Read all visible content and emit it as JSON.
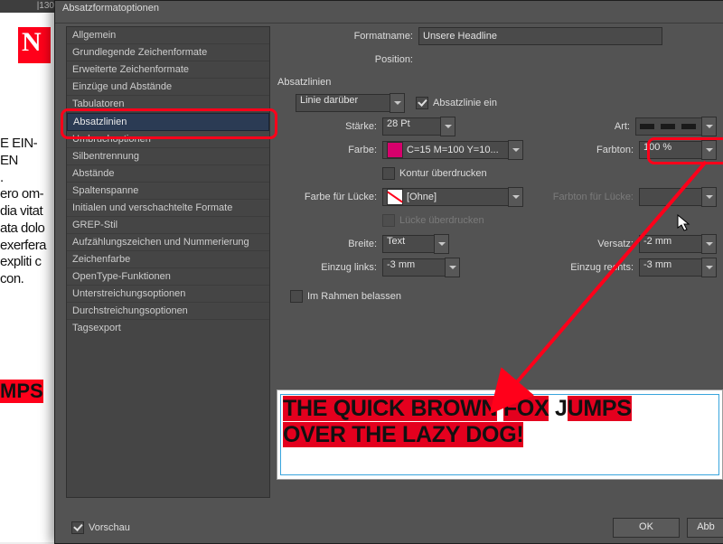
{
  "ruler": "|130",
  "doc": {
    "lines": [
      "E EIN-",
      "EN",
      ".",
      " ",
      "ero om-",
      "dia vitat",
      "ata dolo",
      "exerfera",
      " ",
      "expliti c",
      "con."
    ],
    "jumps": "MPS"
  },
  "dialog": {
    "title": "Absatzformatoptionen"
  },
  "formatname": {
    "label": "Formatname:",
    "value": "Unsere Headline"
  },
  "position_label": "Position:",
  "section": "Absatzlinien",
  "sidebar": [
    "Allgemein",
    "Grundlegende Zeichenformate",
    "Erweiterte Zeichenformate",
    "Einzüge und Abstände",
    "Tabulatoren",
    "Absatzlinien",
    "Umbruchoptionen",
    "Silbentrennung",
    "Abstände",
    "Spaltenspanne",
    "Initialen und verschachtelte Formate",
    "GREP-Stil",
    "Aufzählungszeichen und Nummerierung",
    "Zeichenfarbe",
    "OpenType-Funktionen",
    "Unterstreichungsoptionen",
    "Durchstreichungsoptionen",
    "Tagsexport"
  ],
  "selectedIndex": 5,
  "rules": {
    "which": "Linie darüber",
    "on_label": "Absatzlinie ein",
    "strength_label": "Stärke:",
    "strength": "28 Pt",
    "type_label": "Art:",
    "color_label": "Farbe:",
    "color": "C=15 M=100 Y=10...",
    "tint_label": "Farbton:",
    "tint": "100 %",
    "overprint_stroke": "Kontur überdrucken",
    "gap_color_label": "Farbe für Lücke:",
    "gap_color": "[Ohne]",
    "gap_tint_label": "Farbton für Lücke:",
    "gap_overprint": "Lücke überdrucken",
    "width_label": "Breite:",
    "width": "Text",
    "offset_label": "Versatz:",
    "offset": "-2 mm",
    "indent_left_label": "Einzug links:",
    "indent_left": "-3 mm",
    "indent_right_label": "Einzug rechts:",
    "indent_right": "-3 mm",
    "keep_in_frame": "Im Rahmen belassen"
  },
  "preview_label": "Vorschau",
  "buttons": {
    "ok": "OK",
    "cancel": "Abb"
  },
  "preview_text": {
    "seg": [
      "THE QUICK BR",
      "O",
      "WN",
      " ",
      "FOX",
      " J",
      "UMPS"
    ],
    "seg2": [
      "OVER THE LAZY DOG!"
    ]
  }
}
